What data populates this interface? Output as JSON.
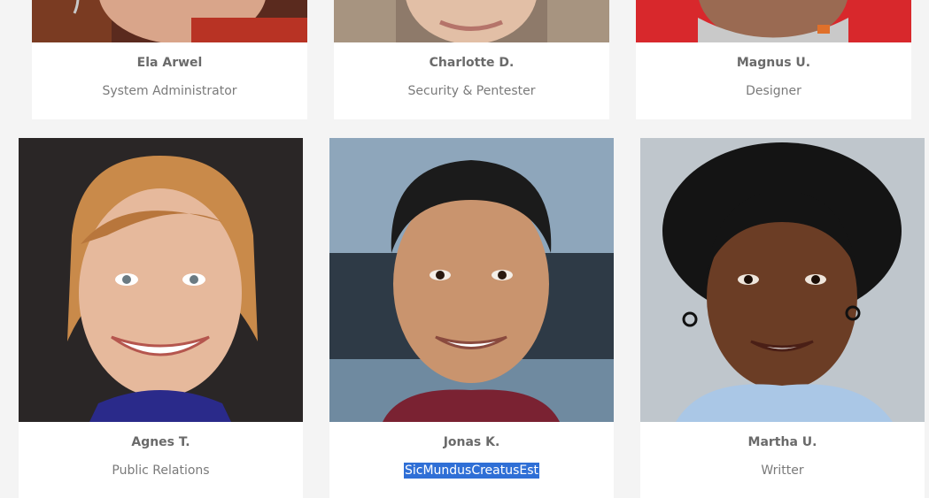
{
  "team": {
    "top_row": [
      {
        "name": "Ela Arwel",
        "role": "System Administrator"
      },
      {
        "name": "Charlotte D.",
        "role": "Security & Pentester"
      },
      {
        "name": "Magnus U.",
        "role": "Designer"
      }
    ],
    "bottom_row": [
      {
        "name": "Agnes T.",
        "role": "Public Relations"
      },
      {
        "name": "Jonas K.",
        "role": "SicMundusCreatusEst"
      },
      {
        "name": "Martha U.",
        "role": "Writter"
      }
    ]
  }
}
